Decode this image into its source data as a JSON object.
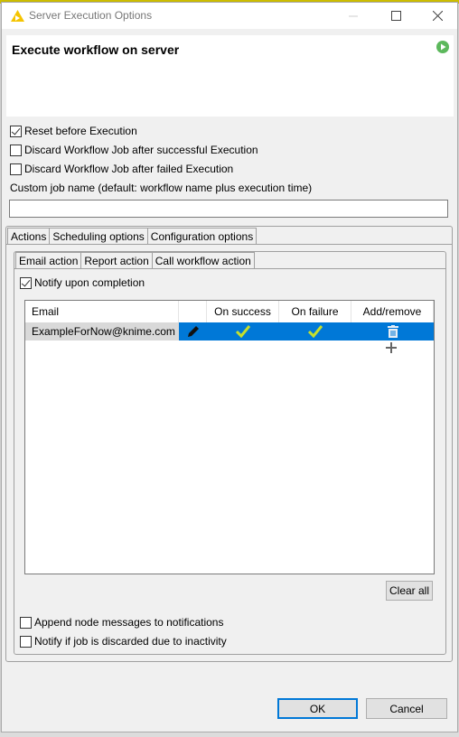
{
  "window": {
    "title": "Server Execution Options",
    "controls": {
      "minimize": "minimize-icon",
      "maximize": "maximize-icon",
      "close": "close-icon"
    }
  },
  "header": {
    "title": "Execute workflow on server",
    "icon": "run-icon"
  },
  "options": {
    "reset_before_execution": {
      "label": "Reset before Execution",
      "checked": true
    },
    "discard_after_success": {
      "label": "Discard Workflow Job after successful Execution",
      "checked": false
    },
    "discard_after_failure": {
      "label": "Discard Workflow Job after failed Execution",
      "checked": false
    }
  },
  "custom_job_name": {
    "label": "Custom job name (default: workflow name plus execution time)",
    "value": ""
  },
  "tabs": [
    {
      "label": "Actions",
      "active": true
    },
    {
      "label": "Scheduling options",
      "active": false
    },
    {
      "label": "Configuration options",
      "active": false
    }
  ],
  "subtabs": [
    {
      "label": "Email action",
      "active": true
    },
    {
      "label": "Report action",
      "active": false
    },
    {
      "label": "Call workflow action",
      "active": false
    }
  ],
  "email_action": {
    "notify_upon_completion": {
      "label": "Notify upon completion",
      "checked": true
    },
    "table": {
      "columns": [
        "Email",
        "",
        "On success",
        "On failure",
        "Add/remove"
      ],
      "rows": [
        {
          "email": "ExampleForNow@knime.com",
          "on_success": true,
          "on_failure": true,
          "selected": true
        }
      ]
    },
    "clear_all_label": "Clear all",
    "append_node_messages": {
      "label": "Append node messages to notifications",
      "checked": false
    },
    "notify_if_discarded": {
      "label": "Notify if job is discarded due to inactivity",
      "checked": false
    }
  },
  "footer": {
    "ok_label": "OK",
    "cancel_label": "Cancel"
  },
  "colors": {
    "selection_blue": "#0078d7",
    "check_yellow_green": "#c6e02c",
    "run_green": "#5cb85c",
    "logo_yellow": "#f5c400"
  }
}
